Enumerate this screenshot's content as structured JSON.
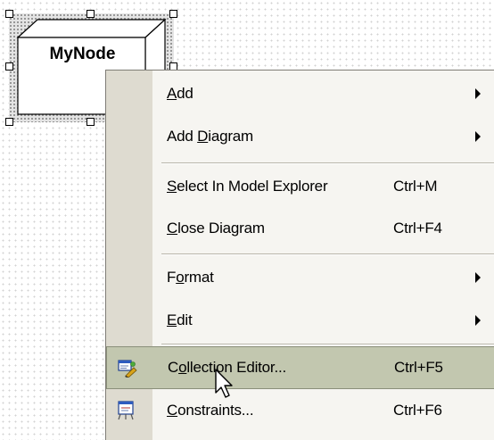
{
  "diagram": {
    "node_label": "MyNode"
  },
  "menu": {
    "items": [
      {
        "label": "Add",
        "mnemonic": "A",
        "shortcut": "",
        "submenu": true,
        "icon": "",
        "highlighted": false
      },
      {
        "label": "Add Diagram",
        "mnemonic": "D",
        "shortcut": "",
        "submenu": true,
        "icon": "",
        "highlighted": false
      },
      {
        "label": "Select In Model Explorer",
        "mnemonic": "S",
        "shortcut": "Ctrl+M",
        "submenu": false,
        "icon": "",
        "highlighted": false
      },
      {
        "label": "Close Diagram",
        "mnemonic": "C",
        "shortcut": "Ctrl+F4",
        "submenu": false,
        "icon": "",
        "highlighted": false
      },
      {
        "label": "Format",
        "mnemonic": "o",
        "shortcut": "",
        "submenu": true,
        "icon": "",
        "highlighted": false
      },
      {
        "label": "Edit",
        "mnemonic": "E",
        "shortcut": "",
        "submenu": true,
        "icon": "",
        "highlighted": false
      },
      {
        "label": "Collection Editor...",
        "mnemonic": "o",
        "shortcut": "Ctrl+F5",
        "submenu": false,
        "icon": "collection-editor-icon",
        "highlighted": true
      },
      {
        "label": "Constraints...",
        "mnemonic": "C",
        "shortcut": "Ctrl+F6",
        "submenu": false,
        "icon": "constraints-icon",
        "highlighted": false
      }
    ]
  },
  "colors": {
    "menu_background": "#f6f5f1",
    "icon_gutter": "#dedbd0",
    "highlight": "#c2c7af",
    "separator": "#b9b6aa"
  }
}
